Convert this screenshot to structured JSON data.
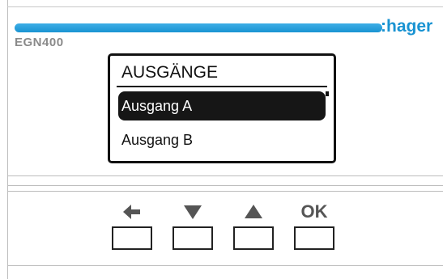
{
  "brand": {
    "logo_text": ":hager",
    "accent_color": "#1993d2"
  },
  "device": {
    "model": "EGN400"
  },
  "screen": {
    "title": "AUSGÄNGE",
    "items": [
      {
        "label": "Ausgang A",
        "selected": true
      },
      {
        "label": "Ausgang B",
        "selected": false
      }
    ]
  },
  "buttons": {
    "back": {
      "icon": "arrow-left-icon"
    },
    "down": {
      "icon": "triangle-down-icon"
    },
    "up": {
      "icon": "triangle-up-icon"
    },
    "ok": {
      "label": "OK"
    }
  }
}
